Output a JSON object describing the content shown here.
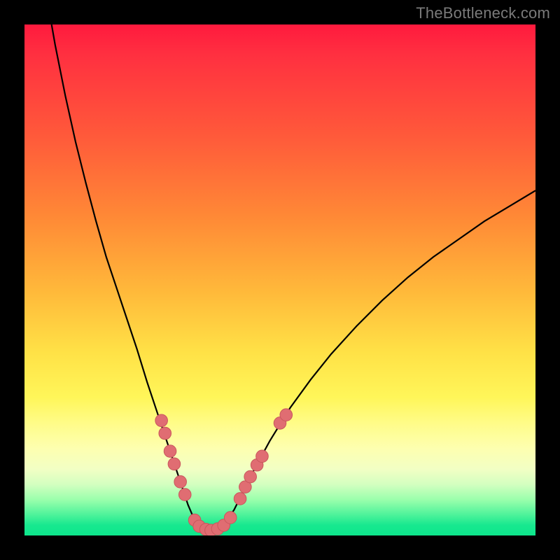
{
  "watermark": "TheBottleneck.com",
  "colors": {
    "frame": "#000000",
    "curve": "#000000",
    "point_fill": "#e06d72",
    "point_stroke": "#c9575d",
    "gradient_top": "#ff1a3e",
    "gradient_bottom": "#0de68c"
  },
  "chart_data": {
    "type": "line",
    "title": "",
    "xlabel": "",
    "ylabel": "",
    "xlim": [
      0,
      100
    ],
    "ylim": [
      0,
      100
    ],
    "curve": {
      "description": "V-shaped bottleneck curve with minimum near x≈36",
      "points": [
        {
          "x": 5.3,
          "y": 100.0
        },
        {
          "x": 6.0,
          "y": 96.0
        },
        {
          "x": 8.0,
          "y": 86.0
        },
        {
          "x": 10.0,
          "y": 77.0
        },
        {
          "x": 12.0,
          "y": 69.0
        },
        {
          "x": 14.0,
          "y": 61.5
        },
        {
          "x": 16.0,
          "y": 54.5
        },
        {
          "x": 18.0,
          "y": 48.5
        },
        {
          "x": 20.0,
          "y": 42.5
        },
        {
          "x": 22.0,
          "y": 36.5
        },
        {
          "x": 24.0,
          "y": 30.0
        },
        {
          "x": 26.0,
          "y": 24.0
        },
        {
          "x": 28.0,
          "y": 18.0
        },
        {
          "x": 30.0,
          "y": 12.0
        },
        {
          "x": 32.0,
          "y": 6.0
        },
        {
          "x": 33.5,
          "y": 2.5
        },
        {
          "x": 35.0,
          "y": 1.2
        },
        {
          "x": 36.0,
          "y": 1.0
        },
        {
          "x": 37.5,
          "y": 1.2
        },
        {
          "x": 39.0,
          "y": 2.2
        },
        {
          "x": 41.0,
          "y": 5.0
        },
        {
          "x": 43.0,
          "y": 9.0
        },
        {
          "x": 45.0,
          "y": 13.0
        },
        {
          "x": 48.0,
          "y": 18.5
        },
        {
          "x": 52.0,
          "y": 25.0
        },
        {
          "x": 56.0,
          "y": 30.5
        },
        {
          "x": 60.0,
          "y": 35.5
        },
        {
          "x": 65.0,
          "y": 41.0
        },
        {
          "x": 70.0,
          "y": 46.0
        },
        {
          "x": 75.0,
          "y": 50.5
        },
        {
          "x": 80.0,
          "y": 54.5
        },
        {
          "x": 85.0,
          "y": 58.0
        },
        {
          "x": 90.0,
          "y": 61.5
        },
        {
          "x": 95.0,
          "y": 64.5
        },
        {
          "x": 100.0,
          "y": 67.5
        }
      ]
    },
    "series": [
      {
        "name": "highlighted-points",
        "type": "scatter",
        "points": [
          {
            "x": 26.8,
            "y": 22.5
          },
          {
            "x": 27.5,
            "y": 20.0
          },
          {
            "x": 28.5,
            "y": 16.5
          },
          {
            "x": 29.3,
            "y": 14.0
          },
          {
            "x": 30.5,
            "y": 10.5
          },
          {
            "x": 31.4,
            "y": 8.0
          },
          {
            "x": 33.3,
            "y": 3.0
          },
          {
            "x": 34.2,
            "y": 1.8
          },
          {
            "x": 35.5,
            "y": 1.2
          },
          {
            "x": 36.5,
            "y": 1.0
          },
          {
            "x": 37.8,
            "y": 1.3
          },
          {
            "x": 39.0,
            "y": 2.0
          },
          {
            "x": 40.3,
            "y": 3.5
          },
          {
            "x": 42.2,
            "y": 7.2
          },
          {
            "x": 43.2,
            "y": 9.5
          },
          {
            "x": 44.2,
            "y": 11.5
          },
          {
            "x": 45.5,
            "y": 13.8
          },
          {
            "x": 46.5,
            "y": 15.5
          },
          {
            "x": 50.0,
            "y": 22.0
          },
          {
            "x": 51.2,
            "y": 23.6
          }
        ]
      }
    ]
  }
}
